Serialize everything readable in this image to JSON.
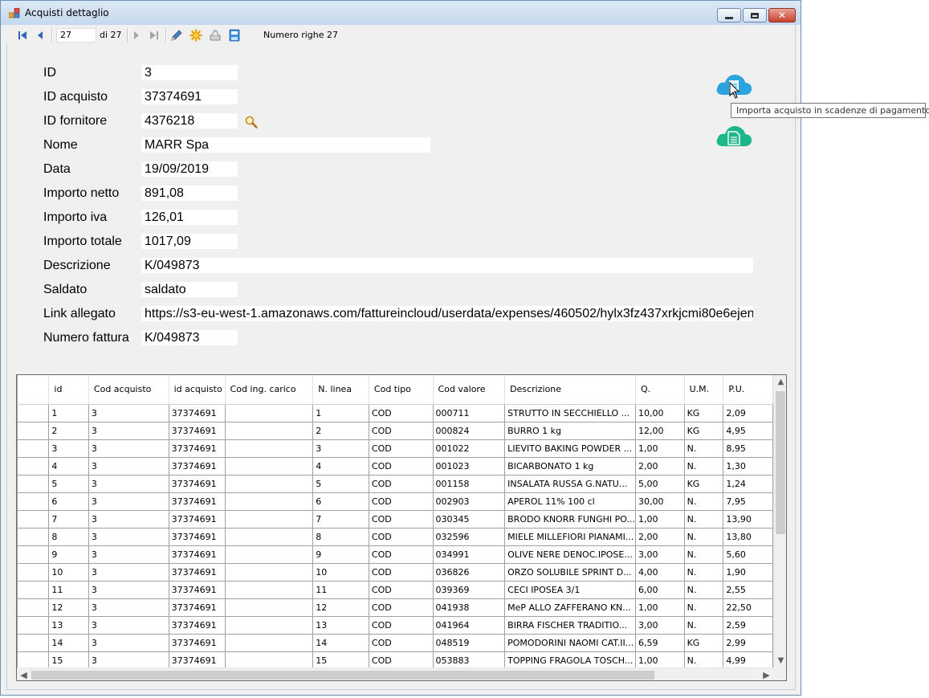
{
  "window": {
    "title": "Acquisti dettaglio"
  },
  "toolbar": {
    "position": "27",
    "of_count": "di 27",
    "row_count": "Numero righe 27"
  },
  "form": {
    "fields": [
      {
        "label": "ID",
        "value": "3"
      },
      {
        "label": "ID acquisto",
        "value": "37374691"
      },
      {
        "label": "ID fornitore",
        "value": "4376218"
      },
      {
        "label": "Nome",
        "value": "MARR Spa"
      },
      {
        "label": "Data",
        "value": "19/09/2019"
      },
      {
        "label": "Importo netto",
        "value": "891,08"
      },
      {
        "label": "Importo iva",
        "value": "126,01"
      },
      {
        "label": "Importo totale",
        "value": "1017,09"
      },
      {
        "label": "Descrizione",
        "value": "K/049873"
      },
      {
        "label": "Saldato",
        "value": "saldato"
      },
      {
        "label": "Link allegato",
        "value": "https://s3-eu-west-1.amazonaws.com/fattureincloud/userdata/expenses/460502/hylx3fz437xrkjcmi80e6ejen"
      },
      {
        "label": "Numero fattura",
        "value": "K/049873"
      }
    ]
  },
  "tooltip": {
    "text": "Importa acquisto in scadenze di pagamento"
  },
  "grid": {
    "columns": [
      "id",
      "Cod acquisto",
      "id acquisto",
      "Cod ing. carico",
      "N. linea",
      "Cod tipo",
      "Cod valore",
      "Descrizione",
      "Q.",
      "U.M.",
      "P.U."
    ],
    "rows": [
      [
        "1",
        "3",
        "37374691",
        "",
        "1",
        "COD",
        "000711",
        "STRUTTO IN SECCHIELLO ...",
        "10,00",
        "KG",
        "2,09"
      ],
      [
        "2",
        "3",
        "37374691",
        "",
        "2",
        "COD",
        "000824",
        "BURRO 1 kg",
        "12,00",
        "KG",
        "4,95"
      ],
      [
        "3",
        "3",
        "37374691",
        "",
        "3",
        "COD",
        "001022",
        "LIEVITO BAKING POWDER ...",
        "1,00",
        "N.",
        "8,95"
      ],
      [
        "4",
        "3",
        "37374691",
        "",
        "4",
        "COD",
        "001023",
        "BICARBONATO 1 kg",
        "2,00",
        "N.",
        "1,30"
      ],
      [
        "5",
        "3",
        "37374691",
        "",
        "5",
        "COD",
        "001158",
        "INSALATA RUSSA G.NATU...",
        "5,00",
        "KG",
        "1,24"
      ],
      [
        "6",
        "3",
        "37374691",
        "",
        "6",
        "COD",
        "002903",
        "APEROL 11% 100 cl",
        "30,00",
        "N.",
        "7,95"
      ],
      [
        "7",
        "3",
        "37374691",
        "",
        "7",
        "COD",
        "030345",
        "BRODO KNORR FUNGHI PO...",
        "1,00",
        "N.",
        "13,90"
      ],
      [
        "8",
        "3",
        "37374691",
        "",
        "8",
        "COD",
        "032596",
        "MIELE MILLEFIORI PIANAMI...",
        "2,00",
        "N.",
        "13,80"
      ],
      [
        "9",
        "3",
        "37374691",
        "",
        "9",
        "COD",
        "034991",
        "OLIVE NERE DENOC.IPOSE...",
        "3,00",
        "N.",
        "5,60"
      ],
      [
        "10",
        "3",
        "37374691",
        "",
        "10",
        "COD",
        "036826",
        "ORZO SOLUBILE SPRINT D...",
        "4,00",
        "N.",
        "1,90"
      ],
      [
        "11",
        "3",
        "37374691",
        "",
        "11",
        "COD",
        "039369",
        "CECI IPOSEA 3/1",
        "6,00",
        "N.",
        "2,55"
      ],
      [
        "12",
        "3",
        "37374691",
        "",
        "12",
        "COD",
        "041938",
        "MeP ALLO ZAFFERANO KN...",
        "1,00",
        "N.",
        "22,50"
      ],
      [
        "13",
        "3",
        "37374691",
        "",
        "13",
        "COD",
        "041964",
        "BIRRA FISCHER TRADITIO...",
        "3,00",
        "N.",
        "2,59"
      ],
      [
        "14",
        "3",
        "37374691",
        "",
        "14",
        "COD",
        "048519",
        "POMODORINI NAOMI CAT.II...",
        "6,59",
        "KG",
        "2,99"
      ],
      [
        "15",
        "3",
        "37374691",
        "",
        "15",
        "COD",
        "053883",
        "TOPPING FRAGOLA TOSCH...",
        "1,00",
        "N.",
        "4,99"
      ]
    ]
  },
  "icons": {
    "first": "first-record-icon",
    "prev": "previous-record-icon",
    "next": "next-record-icon",
    "last": "last-record-icon",
    "edit": "pencil-icon",
    "add": "new-record-icon",
    "delete": "delete-icon",
    "save": "save-icon",
    "lookup": "magnifier-icon",
    "cloud_import": "cloud-import-icon",
    "cloud_doc": "cloud-document-icon"
  },
  "colors": {
    "cloud_blue": "#2aa3df",
    "cloud_green": "#1db58a",
    "nav_blue": "#3166b8"
  }
}
